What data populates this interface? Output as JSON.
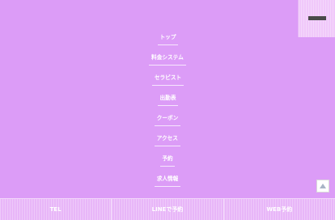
{
  "colors": {
    "background": "#dc9cf7",
    "button_background": "#e8b6f8",
    "text": "#ffffff"
  },
  "menu": {
    "items": [
      {
        "label": "トップ"
      },
      {
        "label": "料金システム"
      },
      {
        "label": "セラピスト"
      },
      {
        "label": "出勤表"
      },
      {
        "label": "クーポン"
      },
      {
        "label": "アクセス"
      },
      {
        "label": "予約"
      },
      {
        "label": "求人情報"
      }
    ]
  },
  "close_button": {
    "icon": "minus-bar-icon"
  },
  "page_top_button": {
    "icon": "triangle-up-icon"
  },
  "bottom_bar": {
    "tel_label": "TEL",
    "line_label": "LINEで予約",
    "web_label": "WEB予約"
  }
}
